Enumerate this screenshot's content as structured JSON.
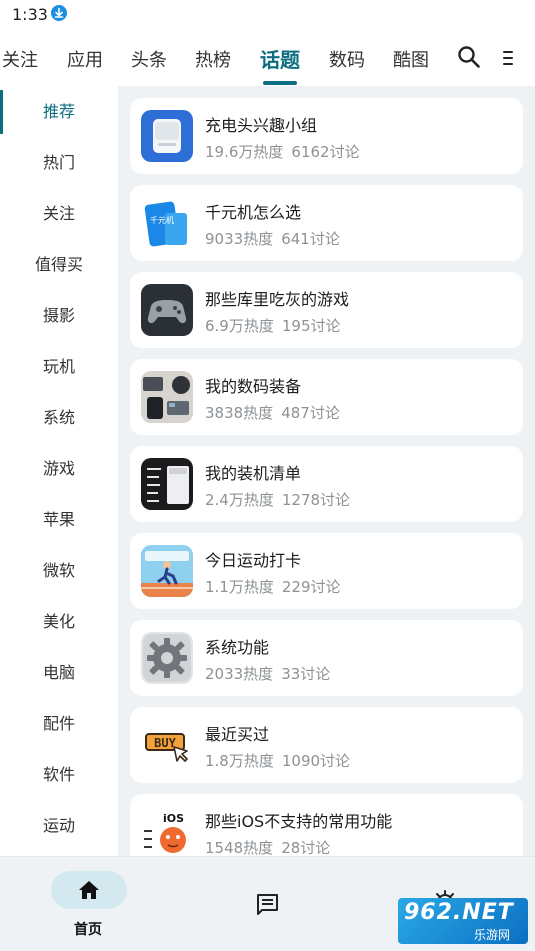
{
  "status": {
    "time": "1:33"
  },
  "tabs": [
    {
      "label": "关注"
    },
    {
      "label": "应用"
    },
    {
      "label": "头条"
    },
    {
      "label": "热榜"
    },
    {
      "label": "话题",
      "active": true
    },
    {
      "label": "数码"
    },
    {
      "label": "酷图"
    }
  ],
  "sidebar": [
    {
      "label": "推荐",
      "active": true
    },
    {
      "label": "热门"
    },
    {
      "label": "关注"
    },
    {
      "label": "值得买"
    },
    {
      "label": "摄影"
    },
    {
      "label": "玩机"
    },
    {
      "label": "系统"
    },
    {
      "label": "游戏"
    },
    {
      "label": "苹果"
    },
    {
      "label": "微软"
    },
    {
      "label": "美化"
    },
    {
      "label": "电脑"
    },
    {
      "label": "配件"
    },
    {
      "label": "软件"
    },
    {
      "label": "运动"
    }
  ],
  "topics": [
    {
      "title": "充电头兴趣小组",
      "heat": "19.6万热度",
      "discuss": "6162讨论",
      "thumb": "charger-thumb"
    },
    {
      "title": "千元机怎么选",
      "heat": "9033热度",
      "discuss": "641讨论",
      "thumb": "phone-thumb",
      "thumb_text": "千元机"
    },
    {
      "title": "那些库里吃灰的游戏",
      "heat": "6.9万热度",
      "discuss": "195讨论",
      "thumb": "gamepad-thumb"
    },
    {
      "title": "我的数码装备",
      "heat": "3838热度",
      "discuss": "487讨论",
      "thumb": "gear-desk-thumb"
    },
    {
      "title": "我的装机清单",
      "heat": "2.4万热度",
      "discuss": "1278讨论",
      "thumb": "pc-case-thumb"
    },
    {
      "title": "今日运动打卡",
      "heat": "1.1万热度",
      "discuss": "229讨论",
      "thumb": "runner-thumb"
    },
    {
      "title": "系统功能",
      "heat": "2033热度",
      "discuss": "33讨论",
      "thumb": "settings-thumb"
    },
    {
      "title": "最近买过",
      "heat": "1.8万热度",
      "discuss": "1090讨论",
      "thumb": "buy-thumb",
      "thumb_text": "BUY"
    },
    {
      "title": "那些iOS不支持的常用功能",
      "heat": "1548热度",
      "discuss": "28讨论",
      "thumb": "ios-thumb",
      "thumb_text": "iOS"
    }
  ],
  "bottom_nav": {
    "home_label": "首页"
  },
  "watermark": {
    "top": "962.NET",
    "bottom": "乐游网"
  },
  "colors": {
    "accent": "#0d6e80",
    "background": "#eef2f5",
    "meta": "#8d9296"
  }
}
